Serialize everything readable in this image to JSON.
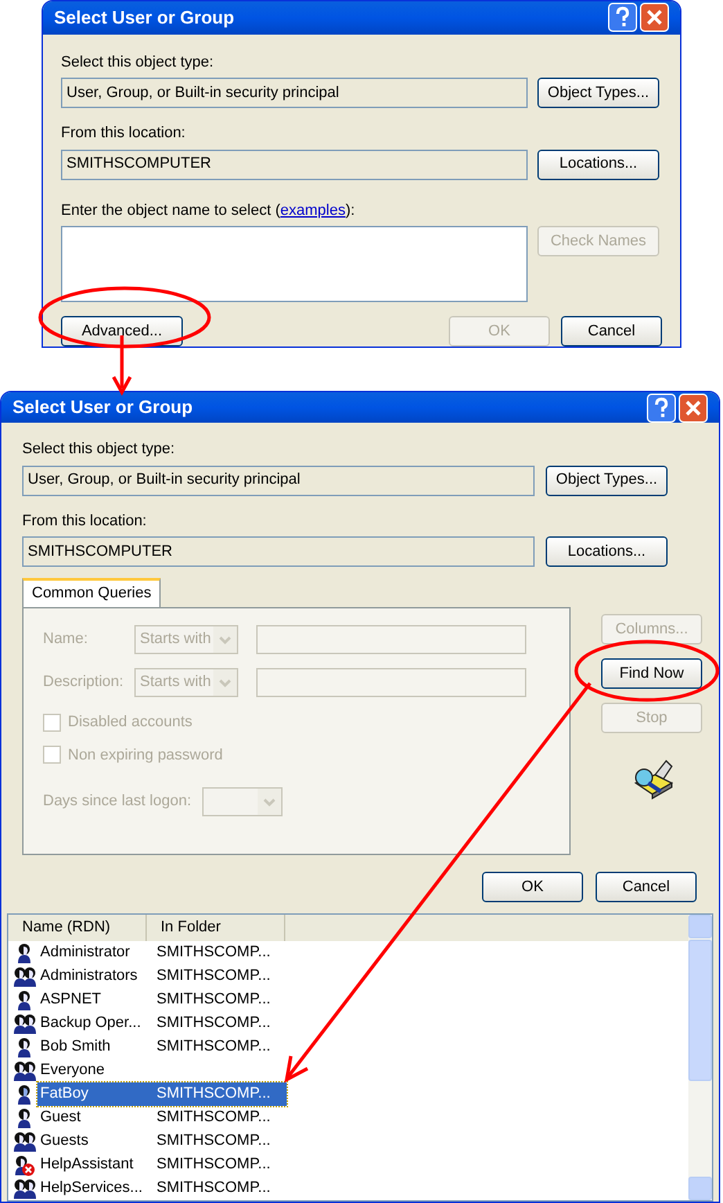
{
  "top_dialog": {
    "title": "Select User or Group",
    "object_type": {
      "label": "Select this object type:",
      "value": "User, Group, or Built-in security principal"
    },
    "object_types_button": {
      "label": "Object Types...",
      "disabled": false
    },
    "location": {
      "label": "From this location:",
      "value": "SMITHSCOMPUTER"
    },
    "locations_button": {
      "label": "Locations...",
      "disabled": false
    },
    "name_entry": {
      "label_before": "Enter the object name to select (",
      "link": "examples",
      "label_after": "):"
    },
    "check_names_button": {
      "label": "Check Names",
      "disabled": true
    },
    "advanced_button": {
      "label": "Advanced...",
      "disabled": false
    },
    "ok_button": {
      "label": "OK",
      "disabled": true
    },
    "cancel_button": {
      "label": "Cancel",
      "disabled": false
    }
  },
  "advanced_dialog": {
    "title": "Select User or Group",
    "object_type": {
      "label": "Select this object type:",
      "value": "User, Group, or Built-in security principal"
    },
    "object_types_button": {
      "label": "Object Types...",
      "disabled": false
    },
    "location": {
      "label": "From this location:",
      "value": "SMITHSCOMPUTER"
    },
    "locations_button": {
      "label": "Locations...",
      "disabled": false
    },
    "tabs": [
      {
        "label": "Common Queries",
        "selected": true
      }
    ],
    "query_fields": [
      {
        "label": "Name:",
        "operator": "Starts with"
      },
      {
        "label": "Description:",
        "operator": "Starts with"
      }
    ],
    "checkboxes": [
      {
        "label": "Disabled accounts",
        "checked": false
      },
      {
        "label": "Non expiring password",
        "checked": false
      }
    ],
    "days_label": "Days since last logon:",
    "side_buttons": [
      {
        "label": "Columns...",
        "disabled": true
      },
      {
        "label": "Find Now",
        "disabled": false
      },
      {
        "label": "Stop",
        "disabled": true
      }
    ],
    "ok_button": {
      "label": "OK",
      "disabled": false
    },
    "cancel_button": {
      "label": "Cancel",
      "disabled": false
    },
    "results": {
      "columns": [
        "Name (RDN)",
        "In Folder"
      ],
      "rows": [
        {
          "name": "Administrator",
          "folder": "SMITHSCOMP...",
          "kind": "user",
          "selected": false
        },
        {
          "name": "Administrators",
          "folder": "SMITHSCOMP...",
          "kind": "group",
          "selected": false
        },
        {
          "name": "ASPNET",
          "folder": "SMITHSCOMP...",
          "kind": "user",
          "selected": false
        },
        {
          "name": "Backup Oper...",
          "folder": "SMITHSCOMP...",
          "kind": "group",
          "selected": false
        },
        {
          "name": "Bob Smith",
          "folder": "SMITHSCOMP...",
          "kind": "user",
          "selected": false
        },
        {
          "name": "Everyone",
          "kind": "group",
          "selected": false
        },
        {
          "name": "FatBoy",
          "folder": "SMITHSCOMP...",
          "kind": "user",
          "selected": true
        },
        {
          "name": "Guest",
          "folder": "SMITHSCOMP...",
          "kind": "user",
          "selected": false
        },
        {
          "name": "Guests",
          "folder": "SMITHSCOMP...",
          "kind": "group",
          "selected": false
        },
        {
          "name": "HelpAssistant",
          "folder": "SMITHSCOMP...",
          "kind": "disabled_user",
          "selected": false
        },
        {
          "name": "HelpServices...",
          "folder": "SMITHSCOMP...",
          "kind": "group",
          "selected": false
        }
      ]
    }
  }
}
